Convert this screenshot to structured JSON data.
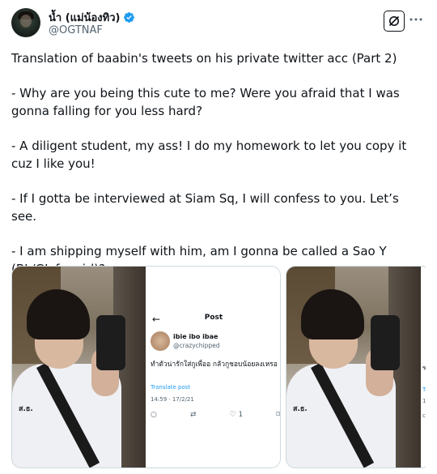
{
  "author": {
    "display_name": "น้ำ (แม่น้องทิว)",
    "handle": "@OGTNAF",
    "verified": true
  },
  "actions": {
    "grok_icon": "grok-icon",
    "more_icon": "more-icon"
  },
  "tweet": {
    "paragraphs": [
      "Translation of baabin's tweets on his private twitter acc (Part 2)",
      "- Why are you being this cute to me? Were you afraid that I was gonna falling for you less hard?",
      "- A diligent student, my ass! I do my homework to let you copy it cuz I like you!",
      "- If I gotta be interviewed at Siam Sq, I will confess to you. Let’s see.",
      "- I am shipping myself with him, am I gonna be called a Sao Y (BL/GL fangirl)?"
    ]
  },
  "media": {
    "photo_tag": "ส.ธ.",
    "screenshot": {
      "title": "Post",
      "name": "ibie ibo ibae",
      "handle": "@crazychipped",
      "text": "ทำตัวน่ารักใส่กูเพื่ออ กลัวกูชอบน้อยลงเหรอ",
      "translate_label": "Translate post",
      "timestamp": "14:59 · 17/2/21",
      "like_count": "1"
    },
    "strip_chars": [
      "ข",
      "Tr",
      "1",
      "c"
    ]
  },
  "colors": {
    "text": "#0f1419",
    "secondary": "#536471",
    "link": "#1d9bf0",
    "verified": "#1d9bf0"
  }
}
